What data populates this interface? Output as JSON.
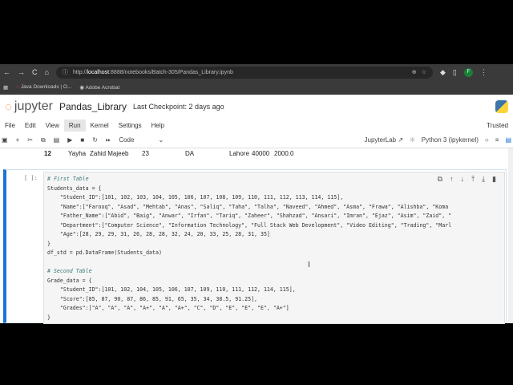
{
  "browser": {
    "url_prefix": "http://",
    "url_host": "localhost",
    "url_rest": ":8888/notebooks/Batch-305/Pandas_Library.ipynb",
    "bookmarks": [
      "Java Downloads | O...",
      "Adobe Acrobat"
    ],
    "profile": "F"
  },
  "header": {
    "brand": "jupyter",
    "notebook": "Pandas_Library",
    "checkpoint": "Last Checkpoint: 2 days ago"
  },
  "menu": {
    "items": [
      "File",
      "Edit",
      "View",
      "Run",
      "Kernel",
      "Settings",
      "Help"
    ],
    "trusted": "Trusted"
  },
  "toolbar": {
    "cell_type": "Code",
    "jupyterlab": "JupyterLab",
    "kernel": "Python 3 (ipykernel)"
  },
  "prev_row": [
    "12",
    "Yayha",
    "Zahid Majeeb",
    "23",
    "DA",
    "Lahore",
    "40000",
    "2000.0"
  ],
  "cell": {
    "prompt": "[ ]:",
    "lines": [
      "# First Table",
      "Students_data = {",
      "    \"Student_ID\":[101, 102, 103, 104, 105, 106, 107, 108, 109, 110, 111, 112, 113, 114, 115],",
      "    \"Name\":[\"Farooq\", \"Asad\", \"Mehtab\", \"Anas\", \"Saliq\", \"Taha\", \"Talha\", \"Naveed\", \"Ahmed\", \"Asma\", \"Frawa\", \"Alishba\", \"Koma",
      "    \"Father_Name\":[\"Abid\", \"Baig\", \"Anwar\", \"Irfan\", \"Tariq\", \"Zaheer\", \"Shahzad\", \"Ansari\", \"Imran\", \"Ejaz\", \"Asim\", \"Zaid\", \"",
      "    \"Department\":[\"Computer Science\", \"Information Technology\", \"Full Stack Web Development\", \"Video Editing\", \"Trading\", \"Marl",
      "    \"Age\":[28, 29, 29, 31, 26, 28, 28, 32, 24, 20, 33, 25, 28, 31, 35]",
      "}",
      "df_std = pd.DataFrame(Students_data)",
      "",
      "# Second Table",
      "Grade_data = {",
      "    \"Student_ID\":[101, 102, 104, 105, 106, 107, 109, 110, 111, 112, 114, 115],",
      "    \"Score\":[85, 87, 90, 87, 86, 85, 91, 65, 35, 34, 38.5, 91.25],",
      "    \"Grades\":[\"A\", \"A\", \"A\", \"A+\", \"A\", \"A+\", \"C\", \"D\", \"E\", \"E\", \"E\", \"A+\"]",
      "}"
    ]
  }
}
